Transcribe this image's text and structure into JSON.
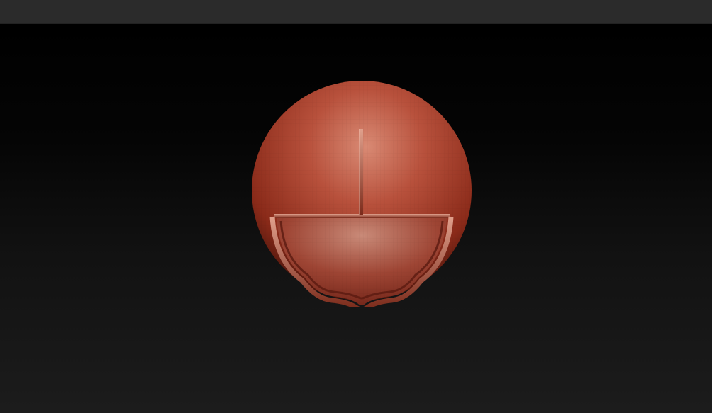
{
  "app": {
    "top_bar_color": "#2b2b2b",
    "viewport_gradient": [
      "#000000",
      "#1c1c1c"
    ]
  },
  "model": {
    "description_icon": "sculpted-sphere-icon",
    "base_color": "#b4432f",
    "shadow_color": "#3a0f08",
    "highlight_color": "#d98a74"
  }
}
